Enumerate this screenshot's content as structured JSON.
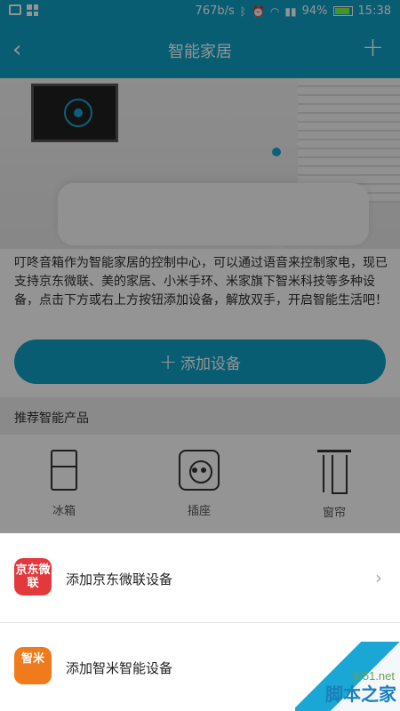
{
  "status_bar": {
    "network_speed": "767b/s",
    "battery_percent": "94%",
    "battery_level": 0.94,
    "time": "15:38"
  },
  "app_bar": {
    "back_glyph": "‹",
    "title": "智能家居",
    "add_glyph": "+"
  },
  "description": "叮咚音箱作为智能家居的控制中心，可以通过语音来控制家电，现已支持京东微联、美的家居、小米手环、米家旗下智米科技等多种设备，点击下方或右上方按钮添加设备，解放双手，开启智能生活吧！",
  "add_device_button": {
    "plus": "+",
    "label": "添加设备"
  },
  "recommend": {
    "title": "推荐智能产品",
    "items": [
      {
        "label": "冰箱",
        "icon": "fridge-icon"
      },
      {
        "label": "插座",
        "icon": "socket-icon"
      },
      {
        "label": "窗帘",
        "icon": "curtain-icon"
      }
    ]
  },
  "sheet": {
    "options": [
      {
        "logo_text": "京东微联",
        "label": "添加京东微联设备",
        "logo_color": "#e4393c",
        "chevron": "›"
      },
      {
        "logo_text": "智米",
        "label": "添加智米智能设备",
        "logo_color": "#f07b1c"
      }
    ]
  },
  "watermark": {
    "domain": "jb51.net",
    "name": "脚本之家"
  },
  "colors": {
    "primary": "#0ea0c7"
  }
}
